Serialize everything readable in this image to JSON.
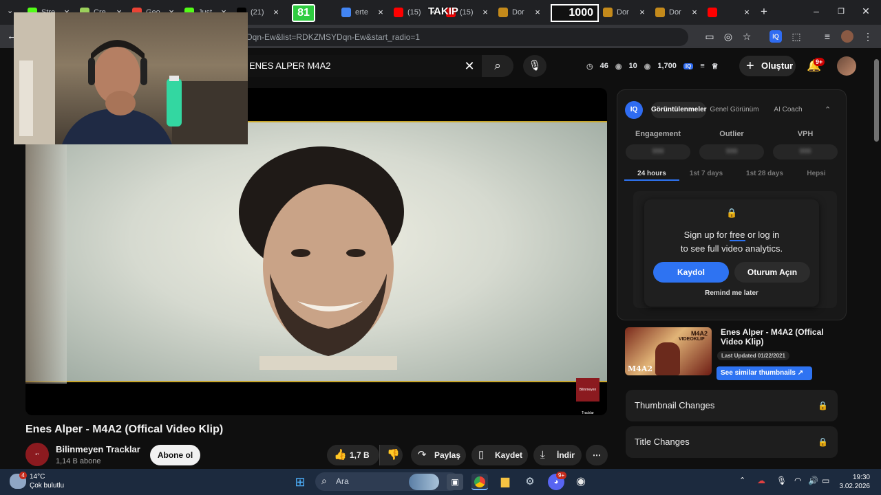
{
  "browser": {
    "tabs": [
      {
        "label": "Stre",
        "color": "#53fc18"
      },
      {
        "label": "Cre",
        "color": "#9bd05b"
      },
      {
        "label": "Geo",
        "color": "#ea4335"
      },
      {
        "label": "Just",
        "color": "#53fc18"
      },
      {
        "label": "(21)",
        "color": "#000000"
      },
      {
        "label": "erte",
        "color": "#4285f4"
      },
      {
        "label": "(15)",
        "color": "#ff0000"
      },
      {
        "label": "(15)",
        "color": "#ff0000"
      },
      {
        "label": "Dor",
        "color": "#c48a1b"
      },
      {
        "label": "T",
        "color": "#c48a1b"
      },
      {
        "label": "Dor",
        "color": "#c48a1b"
      },
      {
        "label": "Dor",
        "color": "#c48a1b"
      },
      {
        "label": "",
        "color": "#ff0000"
      }
    ],
    "url": "Dqn-Ew&list=RDKZMSYDqn-Ew&start_radio=1"
  },
  "overlay": {
    "counter": "81",
    "follow_label": "TAKIP",
    "goal": "1000"
  },
  "youtube": {
    "search_value": "ENES ALPER M4A2",
    "stats": {
      "a": "46",
      "b": "10",
      "c": "1,700"
    },
    "create_label": "Oluştur",
    "notif_badge": "9+"
  },
  "video": {
    "title": "Enes Alper - M4A2 (Offical Video Klip)",
    "channel": "Bilinmeyen Tracklar",
    "subscribers": "1,14 B abone",
    "subscribe_label": "Abone ol",
    "likes": "1,7 B",
    "share_label": "Paylaş",
    "save_label": "Kaydet",
    "download_label": "İndir",
    "watermark": "Bilinmeyen Tracklar"
  },
  "panel": {
    "logo": "IQ",
    "tabs": [
      "Görüntülenmeler",
      "Genel Görünüm",
      "AI Coach"
    ],
    "metrics": [
      "Engagement",
      "Outlier",
      "VPH"
    ],
    "metric_values": [
      "999",
      "999",
      "999"
    ],
    "ranges": [
      "24 hours",
      "1st 7 days",
      "1st 28 days",
      "Hepsi"
    ],
    "modal": {
      "line1_pre": "Sign up for ",
      "line1_link": "free",
      "line1_post": " or log in",
      "line2": "to see full video analytics.",
      "primary": "Kaydol",
      "secondary": "Oturum Açın",
      "remind": "Remind me later"
    },
    "thumb": {
      "title": "Enes Alper - M4A2 (Offical Video Klip)",
      "updated": "Last Updated 01/22/2021",
      "button": "See similar thumbnails ↗",
      "art_top": "M4A2",
      "art_sub": "VIDEOKLIP",
      "art_bottom": "M4A2"
    },
    "locked": [
      "Thumbnail Changes",
      "Title Changes"
    ]
  },
  "taskbar": {
    "temp": "14°C",
    "weather": "Çok bulutlu",
    "weather_badge": "4",
    "search": "Ara",
    "discord_badge": "9+",
    "time": "19:30",
    "date": "3.02.2026"
  }
}
